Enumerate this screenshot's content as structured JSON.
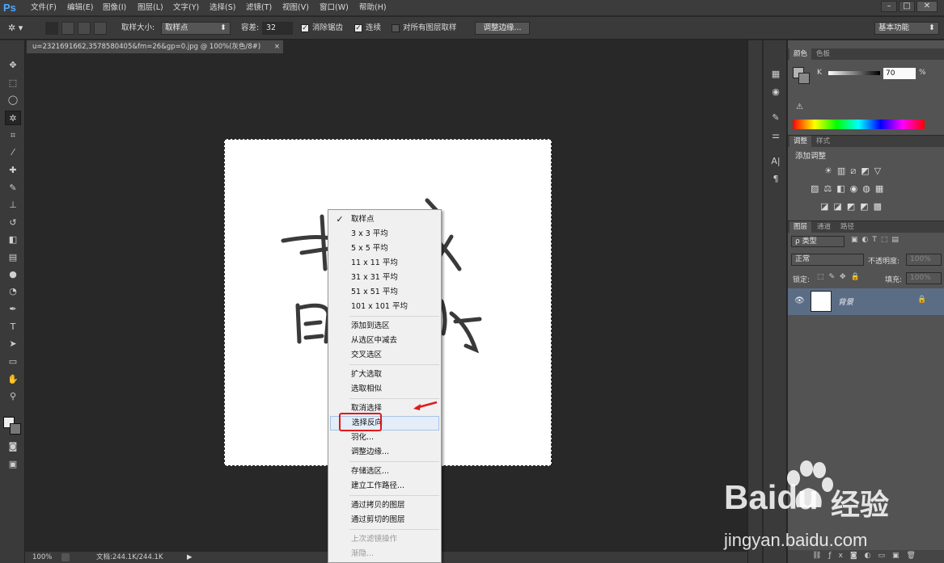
{
  "app": {
    "logo": "Ps"
  },
  "menubar": {
    "items": [
      "文件(F)",
      "编辑(E)",
      "图像(I)",
      "图层(L)",
      "文字(Y)",
      "选择(S)",
      "滤镜(T)",
      "视图(V)",
      "窗口(W)",
      "帮助(H)"
    ],
    "window_buttons": [
      "–",
      "□",
      "✕"
    ]
  },
  "options": {
    "sample_size_label": "取样大小:",
    "sample_size_value": "取样点",
    "tolerance_label": "容差:",
    "tolerance_value": "32",
    "antialias_label": "消除锯齿",
    "contiguous_label": "连续",
    "sample_all_label": "对所有图层取样",
    "refine_edge_button": "调整边缘...",
    "workspace": "基本功能"
  },
  "document": {
    "tab_title": "u=2321691662,3578580405&fm=26&gp=0.jpg @ 100%(灰色/8#)",
    "tab_close": "×"
  },
  "status": {
    "zoom": "100%",
    "doc_info": "文档:244.1K/244.1K"
  },
  "context_menu": {
    "items": [
      {
        "label": "取样点",
        "checked": true
      },
      {
        "label": "3 x 3 平均"
      },
      {
        "label": "5 x 5 平均"
      },
      {
        "label": "11 x 11 平均"
      },
      {
        "label": "31 x 31 平均"
      },
      {
        "label": "51 x 51 平均"
      },
      {
        "label": "101 x 101 平均"
      },
      {
        "label": "添加到选区"
      },
      {
        "label": "从选区中减去"
      },
      {
        "label": "交叉选区"
      },
      {
        "label": "扩大选取"
      },
      {
        "label": "选取相似"
      },
      {
        "label": "取消选择"
      },
      {
        "label": "选择反向",
        "highlighted": true
      },
      {
        "label": "羽化..."
      },
      {
        "label": "调整边缘..."
      },
      {
        "label": "存储选区..."
      },
      {
        "label": "建立工作路径..."
      },
      {
        "label": "通过拷贝的图层"
      },
      {
        "label": "通过剪切的图层"
      },
      {
        "label": "上次滤镜操作",
        "disabled": true
      },
      {
        "label": "渐隐...",
        "disabled": true
      }
    ],
    "checkmark": "✓"
  },
  "panels": {
    "color_tabs": [
      "颜色",
      "色板"
    ],
    "color_channel": "K",
    "color_value": "70",
    "color_unit": "%",
    "adjust_tabs": [
      "调整",
      "样式"
    ],
    "adjust_title": "添加调整",
    "layers_tabs": [
      "图层",
      "通道",
      "路径"
    ],
    "layer_filter": "ρ 类型",
    "blend_mode": "正常",
    "opacity_label": "不透明度:",
    "opacity_value": "100%",
    "lock_label": "锁定:",
    "fill_label": "填充:",
    "fill_value": "100%",
    "layer_name": "背景"
  },
  "watermark": {
    "brand": "Baidu",
    "suffix": "经验",
    "url": "jingyan.baidu.com"
  },
  "colors": {
    "highlight_box": "#e0191b",
    "annotation_arrow": "#e0191b",
    "layer_selected": "#5b6d85"
  }
}
